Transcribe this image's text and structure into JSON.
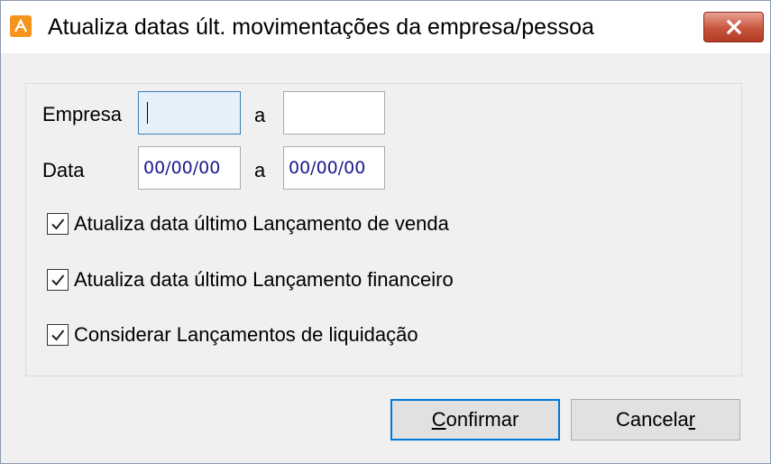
{
  "window": {
    "title": "Atualiza datas últ. movimentações da empresa/pessoa",
    "icon": "app-icon",
    "close_glyph": "close-icon"
  },
  "form": {
    "empresa": {
      "label": "Empresa",
      "from_value": "",
      "separator": "a",
      "to_value": ""
    },
    "data": {
      "label": "Data",
      "from_value": "00/00/00",
      "separator": "a",
      "to_value": "00/00/00"
    },
    "options": [
      {
        "label": "Atualiza data último Lançamento de venda",
        "checked": true
      },
      {
        "label": "Atualiza data último Lançamento financeiro",
        "checked": true
      },
      {
        "label": "Considerar Lançamentos de liquidação",
        "checked": true
      }
    ]
  },
  "buttons": {
    "confirm": {
      "label_pre": "",
      "mnemonic": "C",
      "label_post": "onfirmar"
    },
    "cancel": {
      "label_pre": "Cancela",
      "mnemonic": "r",
      "label_post": ""
    }
  },
  "colors": {
    "date_text": "#1a1a8c",
    "focus_border": "#3c7fb1",
    "close_red": "#c7543d"
  }
}
